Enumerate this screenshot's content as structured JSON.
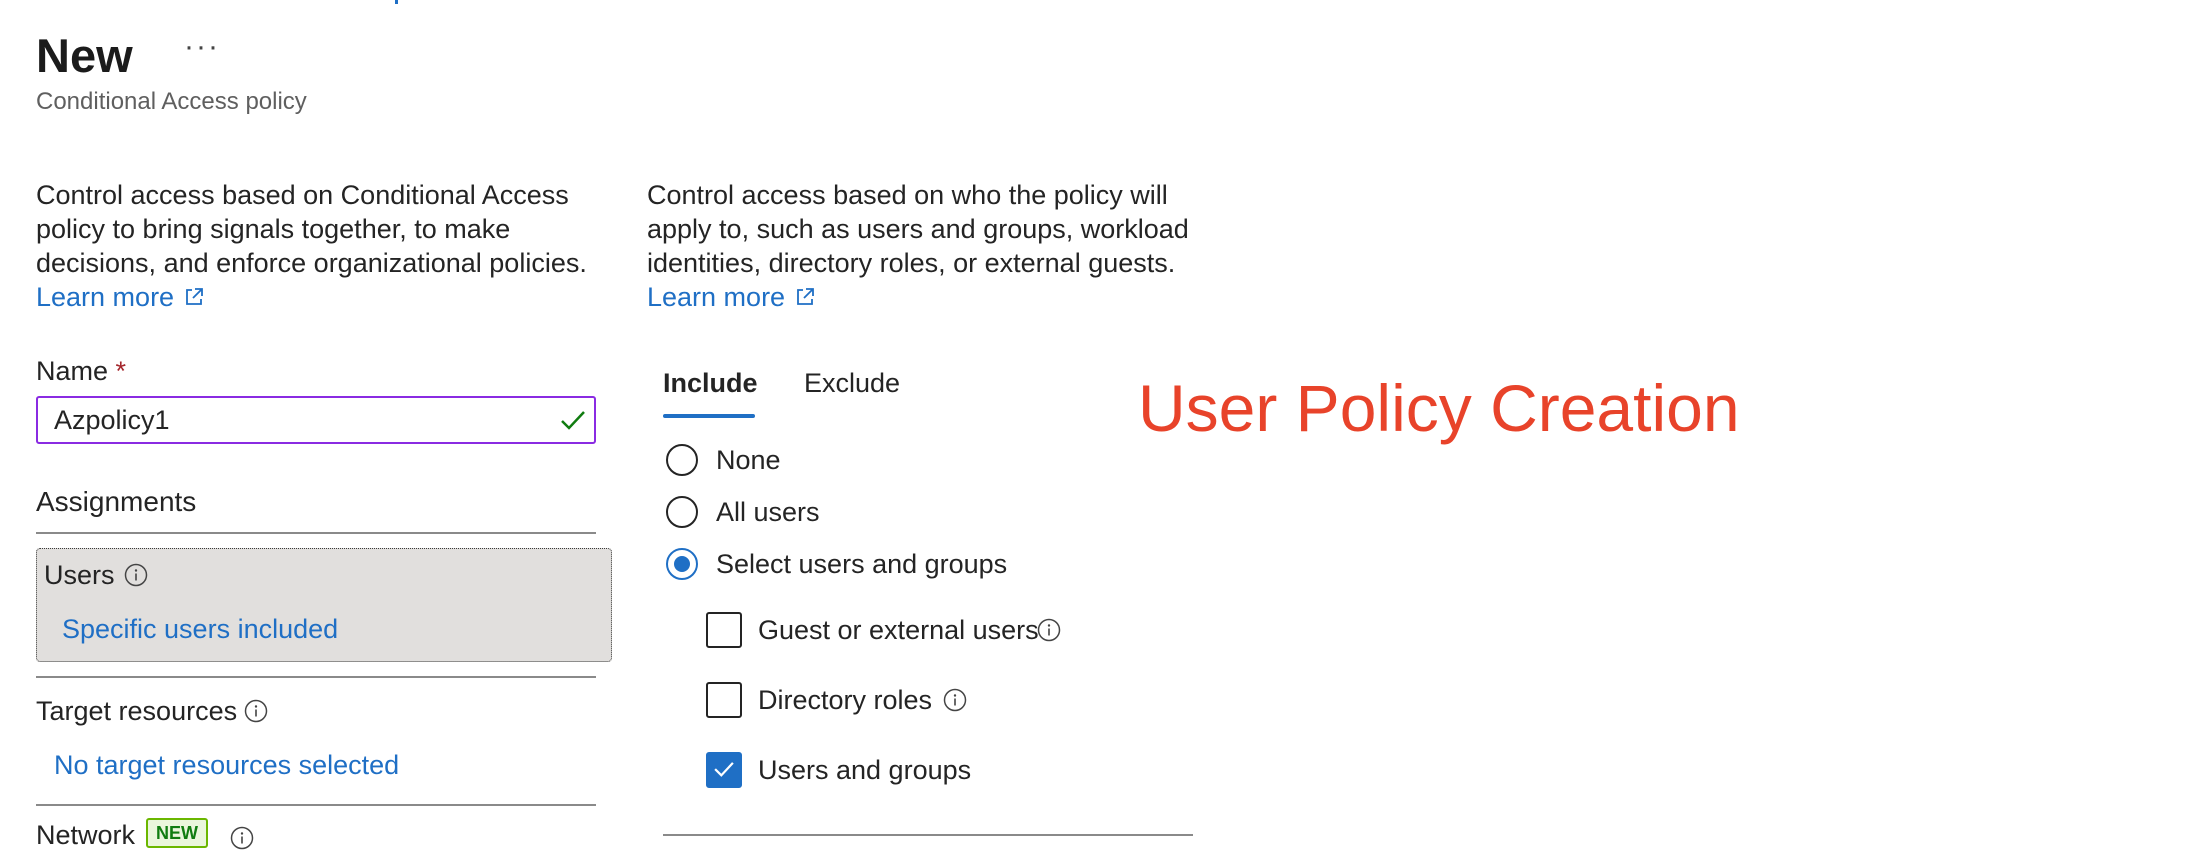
{
  "header": {
    "title": "New",
    "more_label": "···",
    "subtitle": "Conditional Access policy"
  },
  "left_panel": {
    "description": "Control access based on Conditional Access policy to bring signals together, to make decisions, and enforce organizational policies.",
    "learn_more": "Learn more",
    "name_label": "Name",
    "name_required_mark": "*",
    "name_value": "Azpolicy1",
    "assignments_title": "Assignments",
    "users_label": "Users",
    "users_value": "Specific users included",
    "target_resources_label": "Target resources",
    "target_resources_value": "No target resources selected",
    "network_label": "Network",
    "network_badge": "NEW"
  },
  "right_panel": {
    "description": "Control access based on who the policy will apply to, such as users and groups, workload identities, directory roles, or external guests.",
    "learn_more": "Learn more",
    "tabs": [
      {
        "label": "Include",
        "active": true
      },
      {
        "label": "Exclude",
        "active": false
      }
    ],
    "radio_options": [
      {
        "label": "None",
        "selected": false
      },
      {
        "label": "All users",
        "selected": false
      },
      {
        "label": "Select users and groups",
        "selected": true
      }
    ],
    "checkboxes": [
      {
        "label": "Guest or external users",
        "checked": false
      },
      {
        "label": "Directory roles",
        "checked": false
      },
      {
        "label": "Users and groups",
        "checked": true
      }
    ]
  },
  "annotation": "User Policy Creation",
  "colors": {
    "link": "#1f6fc5",
    "annotation": "#e8432a",
    "input_border": "#8a2be2",
    "valid_check": "#107c10",
    "card_bg": "#e1dfdd"
  },
  "icons": [
    "more-icon",
    "external-link-icon",
    "checkmark-icon",
    "info-icon",
    "checkbox-check-icon"
  ]
}
